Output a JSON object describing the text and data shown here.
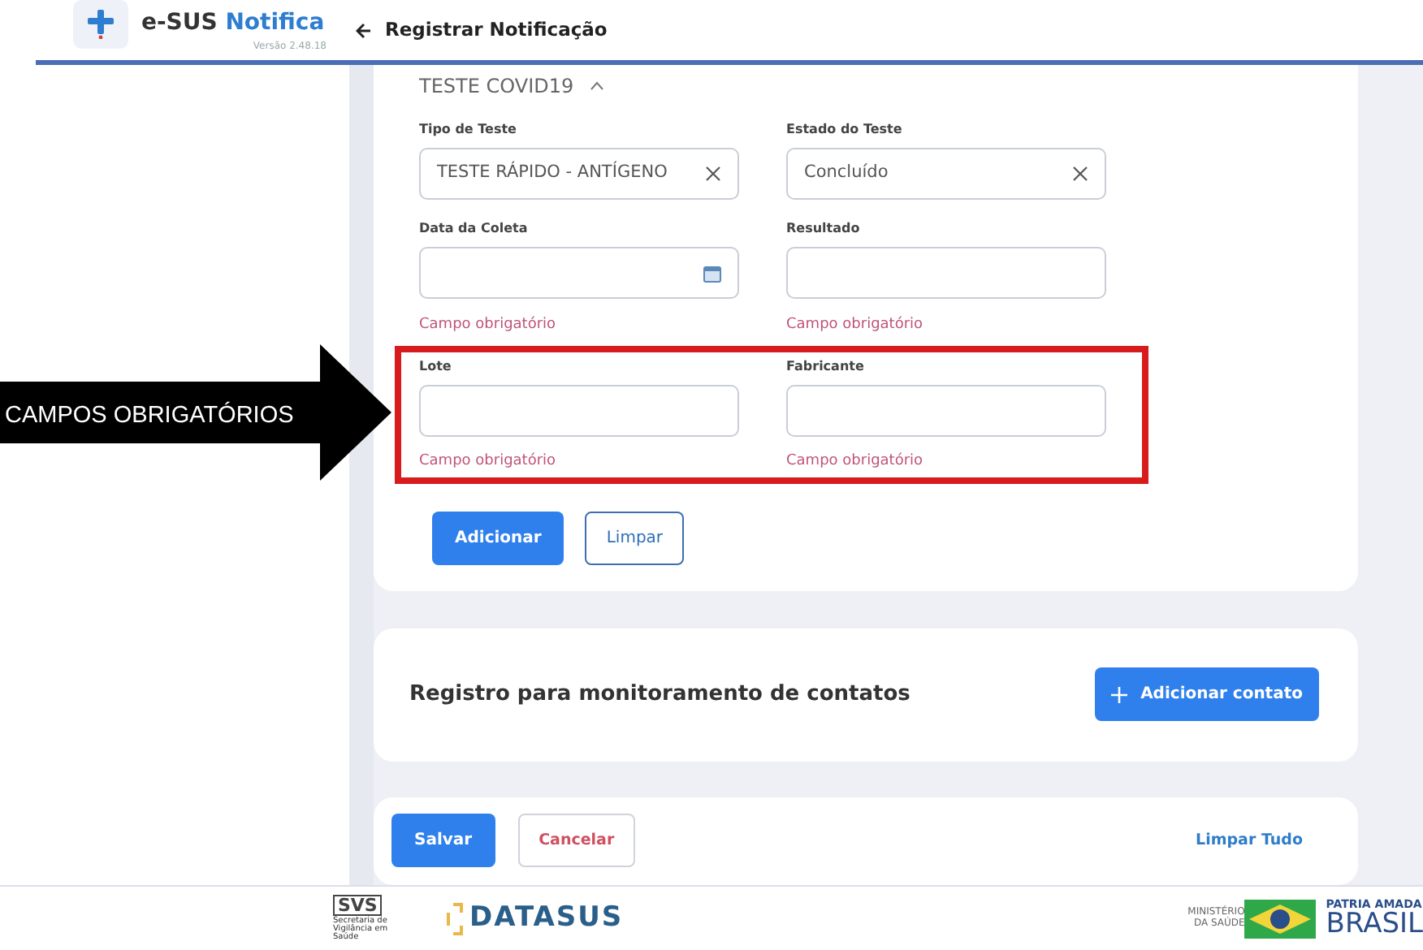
{
  "app": {
    "name_prefix": "e-SUS",
    "name_highlight": "Notifica",
    "version": "Versão 2.48.18"
  },
  "header": {
    "title": "Registrar Notificação"
  },
  "section": {
    "title": "TESTE COVID19",
    "expanded": true,
    "rows": [
      {
        "highlighted": false,
        "fields": [
          {
            "label": "Tipo de Teste",
            "kind": "select",
            "value": "TESTE RÁPIDO - ANTÍGENO"
          },
          {
            "label": "Estado do Teste",
            "kind": "select",
            "value": "Concluído"
          }
        ]
      },
      {
        "highlighted": false,
        "fields": [
          {
            "label": "Data da Coleta",
            "kind": "date",
            "error": "Campo obrigatório"
          },
          {
            "label": "Resultado",
            "kind": "text",
            "error": "Campo obrigatório"
          }
        ]
      },
      {
        "highlighted": true,
        "fields": [
          {
            "label": "Lote",
            "kind": "text",
            "error": "Campo obrigatório"
          },
          {
            "label": "Fabricante",
            "kind": "text",
            "error": "Campo obrigatório"
          }
        ]
      }
    ],
    "buttons": [
      {
        "label": "Adicionar",
        "kind": "primary"
      },
      {
        "label": "Limpar",
        "kind": "outline"
      }
    ]
  },
  "contacts": {
    "title": "Registro para monitoramento de contatos",
    "button": "Adicionar contato"
  },
  "actions": [
    {
      "label": "Salvar",
      "kind": "primary"
    },
    {
      "label": "Cancelar",
      "kind": "danger"
    },
    {
      "label": "Limpar Tudo",
      "kind": "link"
    }
  ],
  "footer": {
    "svs_mark": "SVS",
    "svs_caption": "Secretaria de Vigilância em Saúde",
    "datasus": "DATASUS",
    "ministry": "MINISTÉRIO DA SAÚDE",
    "slogan": "PATRIA AMADA",
    "country": "BRASIL"
  },
  "annotation": {
    "text": "CAMPOS OBRIGATÓRIOS"
  }
}
